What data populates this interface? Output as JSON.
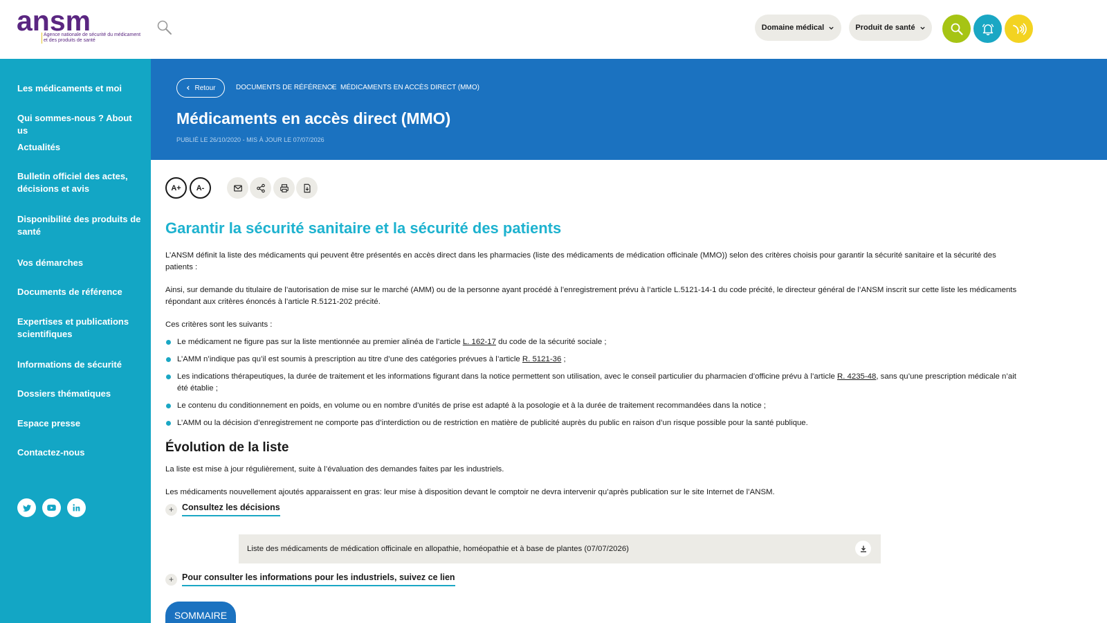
{
  "header": {
    "logo_word_main": "ansm",
    "logo_subtitle": "Agence nationale de sécurité du médicament\net des produits de santé",
    "menu_domaine": "Domaine médical",
    "menu_produit": "Produit de santé",
    "icons": [
      "search-icon",
      "bell-icon",
      "audio-icon"
    ],
    "colors": {
      "search": "#a6c414",
      "bell": "#1aa7c4",
      "audio": "#f3d321"
    }
  },
  "sidebar": {
    "items": [
      {
        "label": "Les médicaments et moi"
      },
      {
        "label": "Qui sommes-nous ? About us"
      },
      {
        "label": "Actualités"
      },
      {
        "label": "Bulletin officiel des actes, décisions et avis"
      },
      {
        "label": "Disponibilité des produits de santé"
      },
      {
        "label": "Vos démarches"
      },
      {
        "label": "Documents de référence"
      },
      {
        "label": "Expertises et publications scientifiques"
      },
      {
        "label": "Informations de sécurité"
      },
      {
        "label": "Dossiers thématiques"
      },
      {
        "label": "Espace presse"
      },
      {
        "label": "Contactez-nous"
      }
    ],
    "social": [
      "twitter-icon",
      "youtube-icon",
      "linkedin-icon"
    ],
    "color": "#13a6c5"
  },
  "hero": {
    "back_label": "Retour",
    "breadcrumb": [
      "DOCUMENTS DE RÉFÉRENCE",
      "MÉDICAMENTS EN ACCÈS DIRECT (MMO)"
    ],
    "breadcrumb_sep": "›",
    "title": "Médicaments en accès direct (MMO)",
    "dates": "PUBLIÉ LE 26/10/2020 - MIS À JOUR LE 07/07/2026",
    "color": "#1b72c0"
  },
  "toolbar": {
    "font_increase": "A+",
    "font_decrease": "A-",
    "actions": [
      "mail-icon",
      "share-icon",
      "print-icon",
      "download-pdf-icon"
    ]
  },
  "article": {
    "heading": "Garantir la sécurité sanitaire et la sécurité des patients",
    "para1": "L’ANSM définit la liste des médicaments qui peuvent être présentés en accès direct dans les pharmacies (liste des médicaments de médication officinale (MMO)) selon des critères choisis pour garantir la sécurité sanitaire et la sécurité des patients :",
    "para2": "Ainsi, sur demande du titulaire de l’autorisation de mise sur le marché (AMM) ou de la personne ayant procédé à l’enregistrement prévu à l’article L.5121-14-1 du code précité, le directeur général de l’ANSM inscrit sur cette liste les médicaments répondant aux critères énoncés à l’article R.5121-202 précité.",
    "criteria_intro": "Ces critères sont les suivants :",
    "criteria": [
      {
        "before": "Le médicament ne figure pas sur la liste mentionnée au premier alinéa de l’article ",
        "link": "L. 162-17",
        "after": " du code de la sécurité sociale ;"
      },
      {
        "before": "L’AMM n’indique pas qu’il est soumis à prescription au titre d’une des catégories prévues à l’article ",
        "link": "R. 5121-36",
        "after": " ;"
      },
      {
        "before": "Les indications thérapeutiques, la durée de traitement et les informations figurant dans la notice permettent son utilisation, avec le conseil particulier du pharmacien d’officine prévu à l’article ",
        "link": "R. 4235-48",
        "after": ", sans qu’une prescription médicale n’ait été établie ;"
      },
      {
        "before": "Le contenu du conditionnement en poids, en volume ou en nombre d’unités de prise est adapté à la posologie et à la durée de traitement recommandées dans la notice ;",
        "link": "",
        "after": ""
      },
      {
        "before": "L’AMM ou la décision d’enregistrement ne comporte pas d’interdiction ou de restriction en matière de publicité auprès du public en raison d’un risque possible pour la santé publique.",
        "link": "",
        "after": ""
      }
    ],
    "section2_heading": "Évolution de la liste",
    "section2_para1": "La liste est mise à jour régulièrement, suite à l’évaluation des demandes faites par les industriels.",
    "section2_para2": "Les médicaments nouvellement ajoutés apparaissent en gras: leur mise à disposition devant le comptoir ne devra intervenir qu’après publication sur le site Internet de l’ANSM.",
    "accordion1_label": "Consultez les décisions",
    "download_label": "Liste des médicaments de médication officinale en allopathie, homéopathie et à base de plantes (07/07/2026)",
    "accordion2_label": "Pour consulter les informations pour les industriels, suivez ce lien",
    "accordion_symbol": "+",
    "heading_color": "#1db2cf",
    "bullet_color": "#1aa7c4"
  },
  "sommaire_label": "SOMMAIRE"
}
